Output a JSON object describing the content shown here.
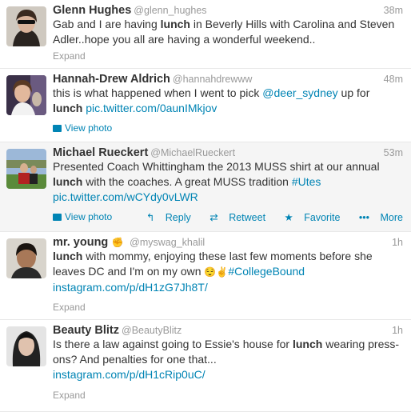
{
  "tweets": [
    {
      "name": "Glenn Hughes",
      "handle": "@glenn_hughes",
      "time": "38m",
      "text_1": "Gab and I are having ",
      "keyword": "lunch",
      "text_2": " in Beverly Hills with Carolina and Steven Adler..hope you all are having a wonderful weekend..",
      "expand": "Expand"
    },
    {
      "name": "Hannah-Drew Aldrich",
      "handle": "@hannahdrewww",
      "time": "48m",
      "text_1": "this is what happened when I went to pick ",
      "mention": "@deer_sydney",
      "text_2": " up for",
      "keyword": "lunch",
      "link": "pic.twitter.com/0aunIMkjov",
      "view_photo": "View photo"
    },
    {
      "name": "Michael Rueckert",
      "handle": "@MichaelRueckert",
      "time": "53m",
      "text_1": "Presented Coach Whittingham the 2013 MUSS shirt at our annual",
      "keyword": "lunch",
      "text_2": " with the coaches. A great MUSS tradition ",
      "hashtag": "#Utes",
      "link": "pic.twitter.com/wCYdy0vLWR",
      "view_photo": "View photo",
      "actions": {
        "reply": "Reply",
        "retweet": "Retweet",
        "favorite": "Favorite",
        "more": "More"
      }
    },
    {
      "name": "mr. young",
      "handle": "@myswag_khalil",
      "time": "1h",
      "keyword": "lunch",
      "text_1": " with mommy, enjoying these last few moments before she leaves DC and I'm on my own ",
      "hashtag": "#CollegeBound",
      "link": "instagram.com/p/dH1zG7Jh8T/",
      "expand": "Expand"
    },
    {
      "name": "Beauty Blitz",
      "handle": "@BeautyBlitz",
      "time": "1h",
      "text_1": "Is there a law against going to Essie's house for ",
      "keyword": "lunch",
      "text_2": " wearing press-ons? And penalties for one that...",
      "link": "instagram.com/p/dH1cRip0uC/",
      "expand": "Expand"
    }
  ],
  "colors": {
    "link": "#0084b4",
    "highlight_bg": "#f5f5f5",
    "meta": "#999999"
  }
}
